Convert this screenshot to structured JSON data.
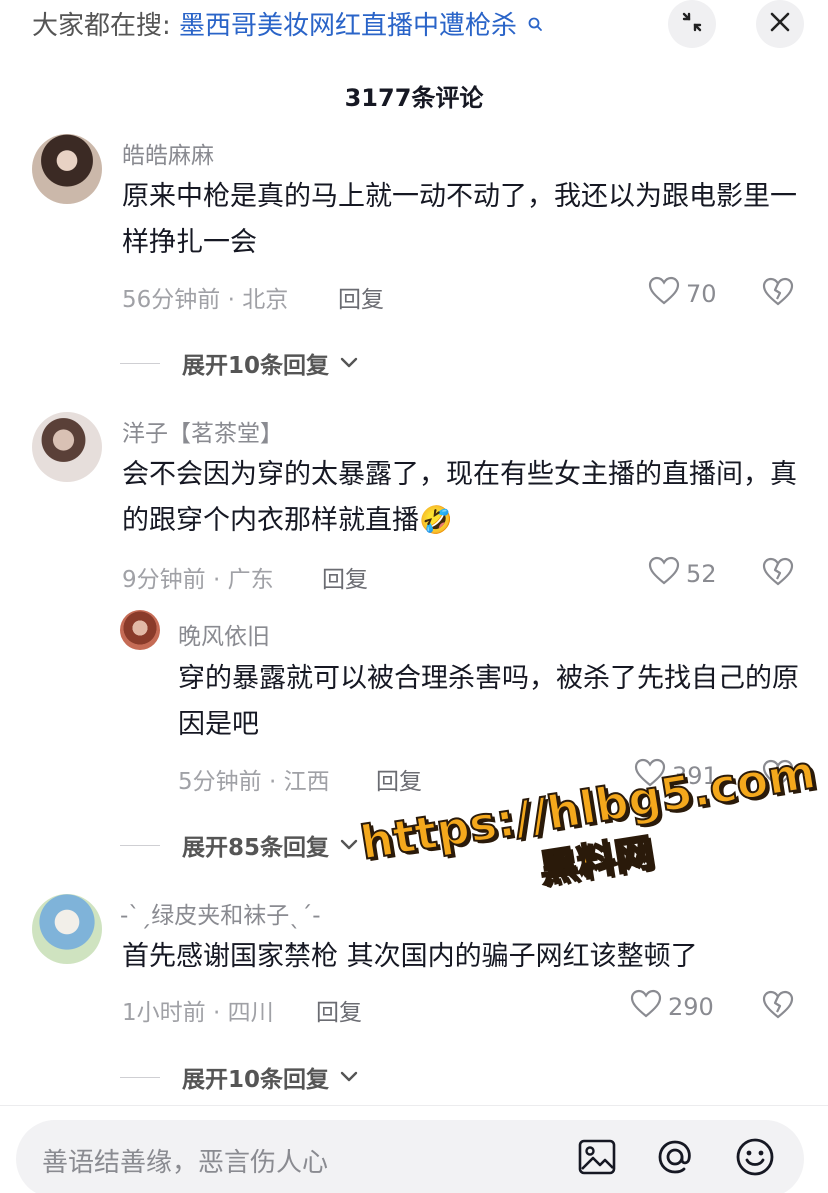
{
  "header": {
    "search_prefix": "大家都在搜:",
    "search_term": "墨西哥美妆网红直播中遭枪杀"
  },
  "comment_count": "3177条评论",
  "comments": [
    {
      "user": "皓皓麻麻",
      "text": "原来中枪是真的马上就一动不动了，我还以为跟电影里一样挣扎一会",
      "meta": "56分钟前 · 北京",
      "reply": "回复",
      "likes": "70",
      "expand": "展开10条回复"
    },
    {
      "user": "洋子【茗茶堂】",
      "text": "会不会因为穿的太暴露了，现在有些女主播的直播间，真的跟穿个内衣那样就直播",
      "emoji": "🤣",
      "meta": "9分钟前 · 广东",
      "reply": "回复",
      "likes": "52",
      "sub_reply": {
        "user": "晚风依旧",
        "text": "穿的暴露就可以被合理杀害吗，被杀了先找自己的原因是吧",
        "meta": "5分钟前 · 江西",
        "reply": "回复",
        "likes": "391"
      },
      "expand": "展开85条回复"
    },
    {
      "user": "-ˋˏ绿皮夹和袜子ˎˊ-",
      "text": "首先感谢国家禁枪 其次国内的骗子网红该整顿了",
      "meta": "1小时前 · 四川",
      "reply": "回复",
      "likes": "290",
      "expand": "展开10条回复"
    }
  ],
  "watermark": {
    "url": "https://hlbg5.com",
    "name": "黑料网"
  },
  "input": {
    "placeholder": "善语结善缘，恶言伤人心"
  },
  "icons": [
    "search-icon",
    "shrink-icon",
    "close-icon",
    "heart-icon",
    "broken-heart-icon",
    "chevron-down-icon",
    "image-icon",
    "at-icon",
    "emoji-icon"
  ]
}
